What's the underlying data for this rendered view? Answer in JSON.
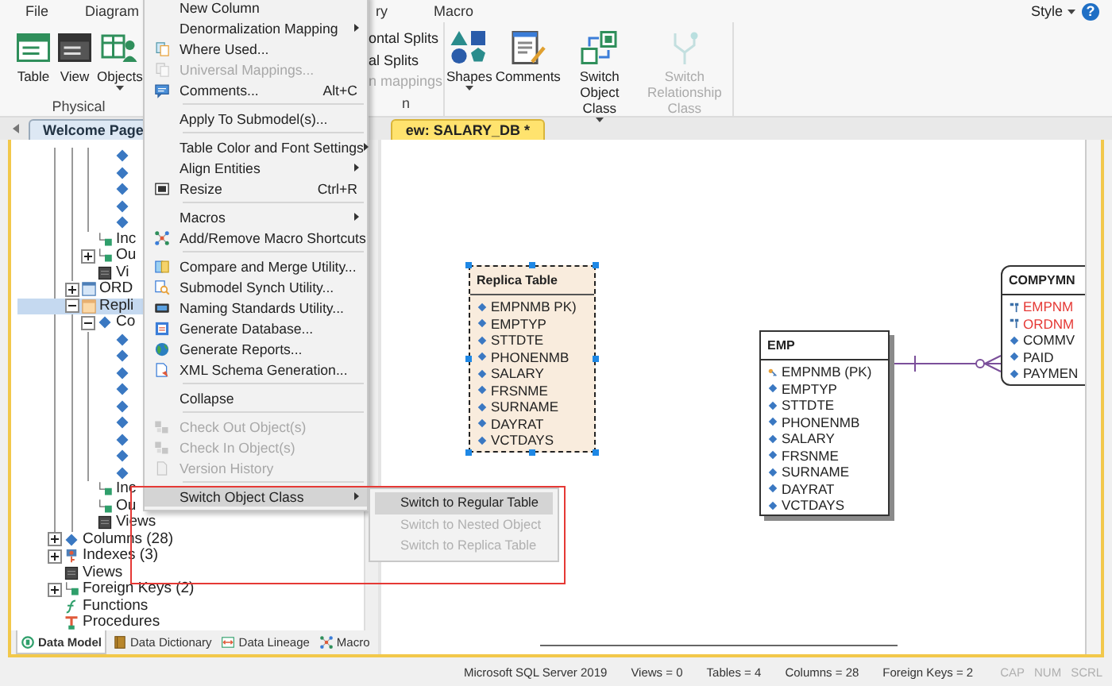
{
  "ribbon": {
    "tabs": [
      {
        "label": "File",
        "selected": false
      },
      {
        "label": "Diagram",
        "selected": false
      },
      {
        "label": "ry",
        "selected": false
      },
      {
        "label": "Macro",
        "selected": false
      }
    ],
    "style_menu": "Style",
    "help": "?",
    "groups": [
      {
        "label": "Physical",
        "buttons": [
          {
            "label": "Table",
            "kind": "large",
            "dropdown": false,
            "disabled": false
          },
          {
            "label": "View",
            "kind": "large",
            "dropdown": false,
            "disabled": false
          },
          {
            "label": "Objects",
            "kind": "large",
            "dropdown": true,
            "disabled": false
          }
        ]
      },
      {
        "label": "n",
        "buttons": [
          {
            "label": "ontal Splits",
            "kind": "small",
            "disabled": false
          },
          {
            "label": "al Splits",
            "kind": "small",
            "disabled": false
          },
          {
            "label": "n mappings",
            "kind": "small",
            "disabled": true
          }
        ]
      },
      {
        "buttons": [
          {
            "label": "Shapes",
            "kind": "large",
            "dropdown": true,
            "disabled": false
          },
          {
            "label": "Comments",
            "kind": "large",
            "dropdown": false,
            "disabled": false
          },
          {
            "label": "Switch Object Class",
            "kind": "large",
            "dropdown": true,
            "disabled": false
          },
          {
            "label": "Switch Relationship Class",
            "kind": "large",
            "dropdown": false,
            "disabled": true
          }
        ]
      }
    ]
  },
  "doc_tabs": [
    {
      "label": "Welcome Page",
      "selected": false
    },
    {
      "label": "ew: SALARY_DB *",
      "selected": true
    }
  ],
  "tree": [
    {
      "children": [
        {
          "children": [
            {
              "children": [
                {
                  "kind": "column"
                },
                {
                  "kind": "column"
                },
                {
                  "kind": "column"
                },
                {
                  "kind": "column"
                },
                {
                  "kind": "column"
                }
              ]
            },
            {
              "label": "Inc",
              "kind": "index",
              "selected": false
            },
            {
              "label": "Ou",
              "kind": "fkey",
              "expanded": false,
              "selected": false
            },
            {
              "label": "Vi",
              "kind": "view",
              "selected": false
            }
          ]
        },
        {
          "label": "ORD",
          "kind": "table",
          "expanded": false,
          "selected": false
        },
        {
          "label": "Repli",
          "kind": "replica",
          "expanded": true,
          "selected": true,
          "children": [
            {
              "label": "Co",
              "kind": "column",
              "expanded": true,
              "selected": false,
              "children": [
                {
                  "kind": "column"
                },
                {
                  "kind": "column"
                },
                {
                  "kind": "column"
                },
                {
                  "kind": "column"
                },
                {
                  "kind": "column"
                },
                {
                  "kind": "column"
                },
                {
                  "kind": "column"
                },
                {
                  "kind": "column"
                },
                {
                  "kind": "column"
                }
              ]
            },
            {
              "label": "Inc",
              "kind": "index",
              "selected": false
            },
            {
              "label": "Ou",
              "kind": "fkey",
              "selected": false
            },
            {
              "label": "Views",
              "kind": "view",
              "selected": false
            }
          ]
        }
      ]
    },
    {
      "label": "Columns (28)",
      "kind": "column",
      "expanded": false,
      "selected": false
    },
    {
      "label": "Indexes (3)",
      "kind": "key",
      "expanded": false,
      "selected": false
    },
    {
      "label": "Views",
      "kind": "view",
      "selected": false
    },
    {
      "label": "Foreign Keys (2)",
      "kind": "fkey",
      "expanded": false,
      "selected": false
    },
    {
      "label": "Functions",
      "kind": "function",
      "selected": false
    },
    {
      "label": "Procedures",
      "kind": "procedure",
      "selected": false
    }
  ],
  "pane_tabs": [
    {
      "label": "Data Model",
      "selected": true
    },
    {
      "label": "Data Dictionary",
      "selected": false
    },
    {
      "label": "Data Lineage",
      "selected": false
    },
    {
      "label": "Macro",
      "selected": false
    }
  ],
  "entities": [
    {
      "name": "Replica Table",
      "kind": "replica",
      "selected": true,
      "rows": [
        {
          "label": "EMPNMB PK)",
          "kind": "attribute"
        },
        {
          "label": "EMPTYP",
          "kind": "attribute"
        },
        {
          "label": "STTDTE",
          "kind": "attribute"
        },
        {
          "label": "PHONENMB",
          "kind": "attribute"
        },
        {
          "label": "SALARY",
          "kind": "attribute"
        },
        {
          "label": "FRSNME",
          "kind": "attribute"
        },
        {
          "label": "SURNAME",
          "kind": "attribute"
        },
        {
          "label": "DAYRAT",
          "kind": "attribute"
        },
        {
          "label": "VCTDAYS",
          "kind": "attribute"
        }
      ]
    },
    {
      "name": "EMP",
      "kind": "independent",
      "selected": false,
      "rows": [
        {
          "label": "EMPNMB (PK)",
          "kind": "pk"
        },
        {
          "label": "EMPTYP",
          "kind": "attribute"
        },
        {
          "label": "STTDTE",
          "kind": "attribute"
        },
        {
          "label": "PHONENMB",
          "kind": "attribute"
        },
        {
          "label": "SALARY",
          "kind": "attribute"
        },
        {
          "label": "FRSNME",
          "kind": "attribute"
        },
        {
          "label": "SURNAME",
          "kind": "attribute"
        },
        {
          "label": "DAYRAT",
          "kind": "attribute"
        },
        {
          "label": "VCTDAYS",
          "kind": "attribute"
        }
      ]
    },
    {
      "name": "COMPYMN",
      "kind": "dependent",
      "selected": false,
      "rows": [
        {
          "label": "EMPNM",
          "kind": "fk"
        },
        {
          "label": "ORDNM",
          "kind": "fk"
        },
        {
          "label": "COMMV",
          "kind": "attribute"
        },
        {
          "label": "PAID",
          "kind": "attribute"
        },
        {
          "label": "PAYMEN",
          "kind": "attribute"
        }
      ]
    }
  ],
  "context_menu": {
    "highlight_box": true,
    "items": [
      {
        "kind": "item",
        "label": "New Column",
        "submenu": false,
        "disabled": false,
        "highlighted": false
      },
      {
        "kind": "item",
        "label": "Denormalization Mapping",
        "submenu": true,
        "disabled": false,
        "highlighted": false
      },
      {
        "kind": "item",
        "label": "Where Used...",
        "submenu": false,
        "disabled": false,
        "highlighted": false
      },
      {
        "kind": "item",
        "label": "Universal Mappings...",
        "submenu": false,
        "disabled": true,
        "highlighted": false
      },
      {
        "kind": "item",
        "label": "Comments...",
        "shortcut": "Alt+C",
        "submenu": false,
        "disabled": false,
        "highlighted": false
      },
      {
        "kind": "separator"
      },
      {
        "kind": "item",
        "label": "Apply To Submodel(s)...",
        "submenu": false,
        "disabled": false,
        "highlighted": false
      },
      {
        "kind": "separator"
      },
      {
        "kind": "item",
        "label": "Table Color and Font Settings",
        "submenu": true,
        "disabled": false,
        "highlighted": false
      },
      {
        "kind": "item",
        "label": "Align Entities",
        "submenu": true,
        "disabled": false,
        "highlighted": false
      },
      {
        "kind": "item",
        "label": "Resize",
        "shortcut": "Ctrl+R",
        "submenu": false,
        "disabled": false,
        "highlighted": false
      },
      {
        "kind": "separator"
      },
      {
        "kind": "item",
        "label": "Macros",
        "submenu": true,
        "disabled": false,
        "highlighted": false
      },
      {
        "kind": "item",
        "label": "Add/Remove Macro Shortcuts",
        "submenu": false,
        "disabled": false,
        "highlighted": false
      },
      {
        "kind": "separator"
      },
      {
        "kind": "item",
        "label": "Compare and Merge Utility...",
        "submenu": false,
        "disabled": false,
        "highlighted": false
      },
      {
        "kind": "item",
        "label": "Submodel Synch Utility...",
        "submenu": false,
        "disabled": false,
        "highlighted": false
      },
      {
        "kind": "item",
        "label": "Naming Standards Utility...",
        "submenu": false,
        "disabled": false,
        "highlighted": false
      },
      {
        "kind": "item",
        "label": "Generate Database...",
        "submenu": false,
        "disabled": false,
        "highlighted": false
      },
      {
        "kind": "item",
        "label": "Generate Reports...",
        "submenu": false,
        "disabled": false,
        "highlighted": false
      },
      {
        "kind": "item",
        "label": "XML Schema Generation...",
        "submenu": false,
        "disabled": false,
        "highlighted": false
      },
      {
        "kind": "separator"
      },
      {
        "kind": "item",
        "label": "Collapse",
        "submenu": false,
        "disabled": false,
        "highlighted": false
      },
      {
        "kind": "separator"
      },
      {
        "kind": "item",
        "label": "Check Out Object(s)",
        "submenu": false,
        "disabled": true,
        "highlighted": false
      },
      {
        "kind": "item",
        "label": "Check In Object(s)",
        "submenu": false,
        "disabled": true,
        "highlighted": false
      },
      {
        "kind": "item",
        "label": "Version History",
        "submenu": false,
        "disabled": true,
        "highlighted": false
      },
      {
        "kind": "separator"
      },
      {
        "kind": "item",
        "label": "Switch Object Class",
        "submenu": true,
        "disabled": false,
        "highlighted": true
      }
    ],
    "submenu": [
      {
        "label": "Switch to Regular Table",
        "disabled": false,
        "highlighted": true
      },
      {
        "label": "Switch to Nested Object",
        "disabled": true,
        "highlighted": false
      },
      {
        "label": "Switch to Replica Table",
        "disabled": true,
        "highlighted": false
      }
    ]
  },
  "status_bar": {
    "database": "Microsoft SQL Server 2019",
    "counts": [
      "Views = 0",
      "Tables = 4",
      "Columns = 28",
      "Foreign Keys = 2"
    ],
    "indicators": [
      {
        "label": "CAP",
        "on": false
      },
      {
        "label": "NUM",
        "on": false
      },
      {
        "label": "SCRL",
        "on": false
      }
    ]
  }
}
